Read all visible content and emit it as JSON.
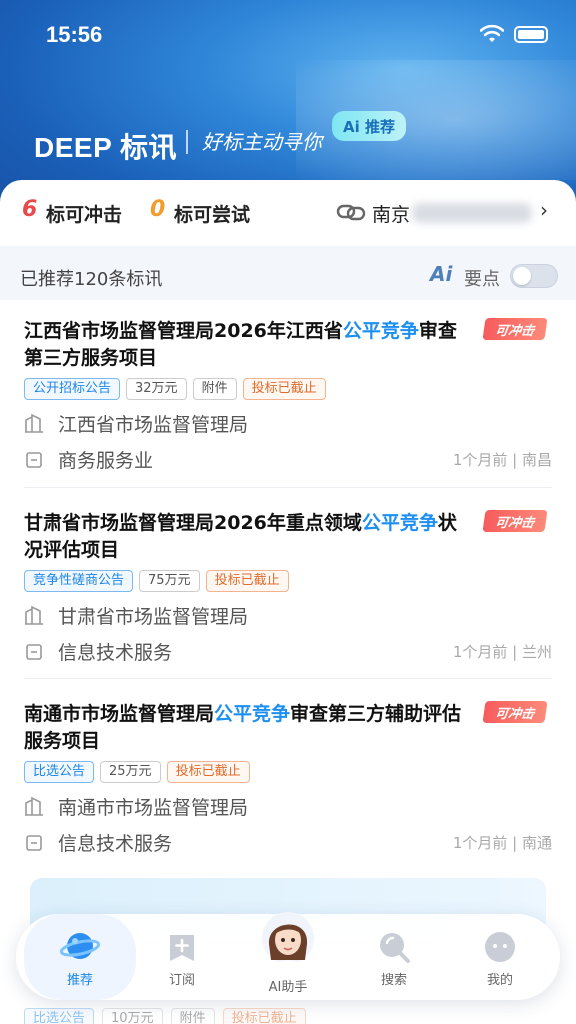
{
  "status_bar": {
    "time": "15:56"
  },
  "header": {
    "brand": "DEEP 标讯",
    "slogan": "好标主动寻你",
    "ai_badge": "Ai 推荐"
  },
  "summary": {
    "hit_count": "6",
    "hit_label": "标可冲击",
    "try_count": "0",
    "try_label": "标可尝试",
    "location": "南京",
    "colors": {
      "hit": "#e84a4a",
      "try": "#f39c2c"
    }
  },
  "list_header": {
    "count_text": "已推荐120条标讯",
    "ai_icon": "Ai",
    "key_label": "要点"
  },
  "items": [
    {
      "title_pre": "江西省市场监督管理局2026年江西省",
      "title_hl": "公平竞争",
      "title_post": "审查第三方服务项目",
      "badge": "可冲击",
      "tags": [
        "公开招标公告",
        "32万元",
        "附件",
        "投标已截止"
      ],
      "org": "江西省市场监督管理局",
      "industry": "商务服务业",
      "meta": "1个月前 | 南昌"
    },
    {
      "title_pre": "甘肃省市场监督管理局2026年重点领域",
      "title_hl": "公平竞争",
      "title_post": "状况评估项目",
      "badge": "可冲击",
      "tags": [
        "竞争性磋商公告",
        "75万元",
        "投标已截止"
      ],
      "org": "甘肃省市场监督管理局",
      "industry": "信息技术服务",
      "meta": "1个月前 | 兰州"
    },
    {
      "title_pre": "南通市市场监督管理局",
      "title_hl": "公平竞争",
      "title_post": "审查第三方辅助评估服务项目",
      "badge": "可冲击",
      "tags": [
        "比选公告",
        "25万元",
        "投标已截止"
      ],
      "org": "南通市市场监督管理局",
      "industry": "信息技术服务",
      "meta": "1个月前 | 南通"
    }
  ],
  "bottom_ghost_tags": [
    "比选公告",
    "10万元",
    "附件",
    "投标已截止"
  ],
  "tabbar": {
    "tabs": [
      "推荐",
      "订阅",
      "AI助手",
      "搜索",
      "我的"
    ],
    "active": "推荐",
    "accent": "#1d86e8"
  }
}
